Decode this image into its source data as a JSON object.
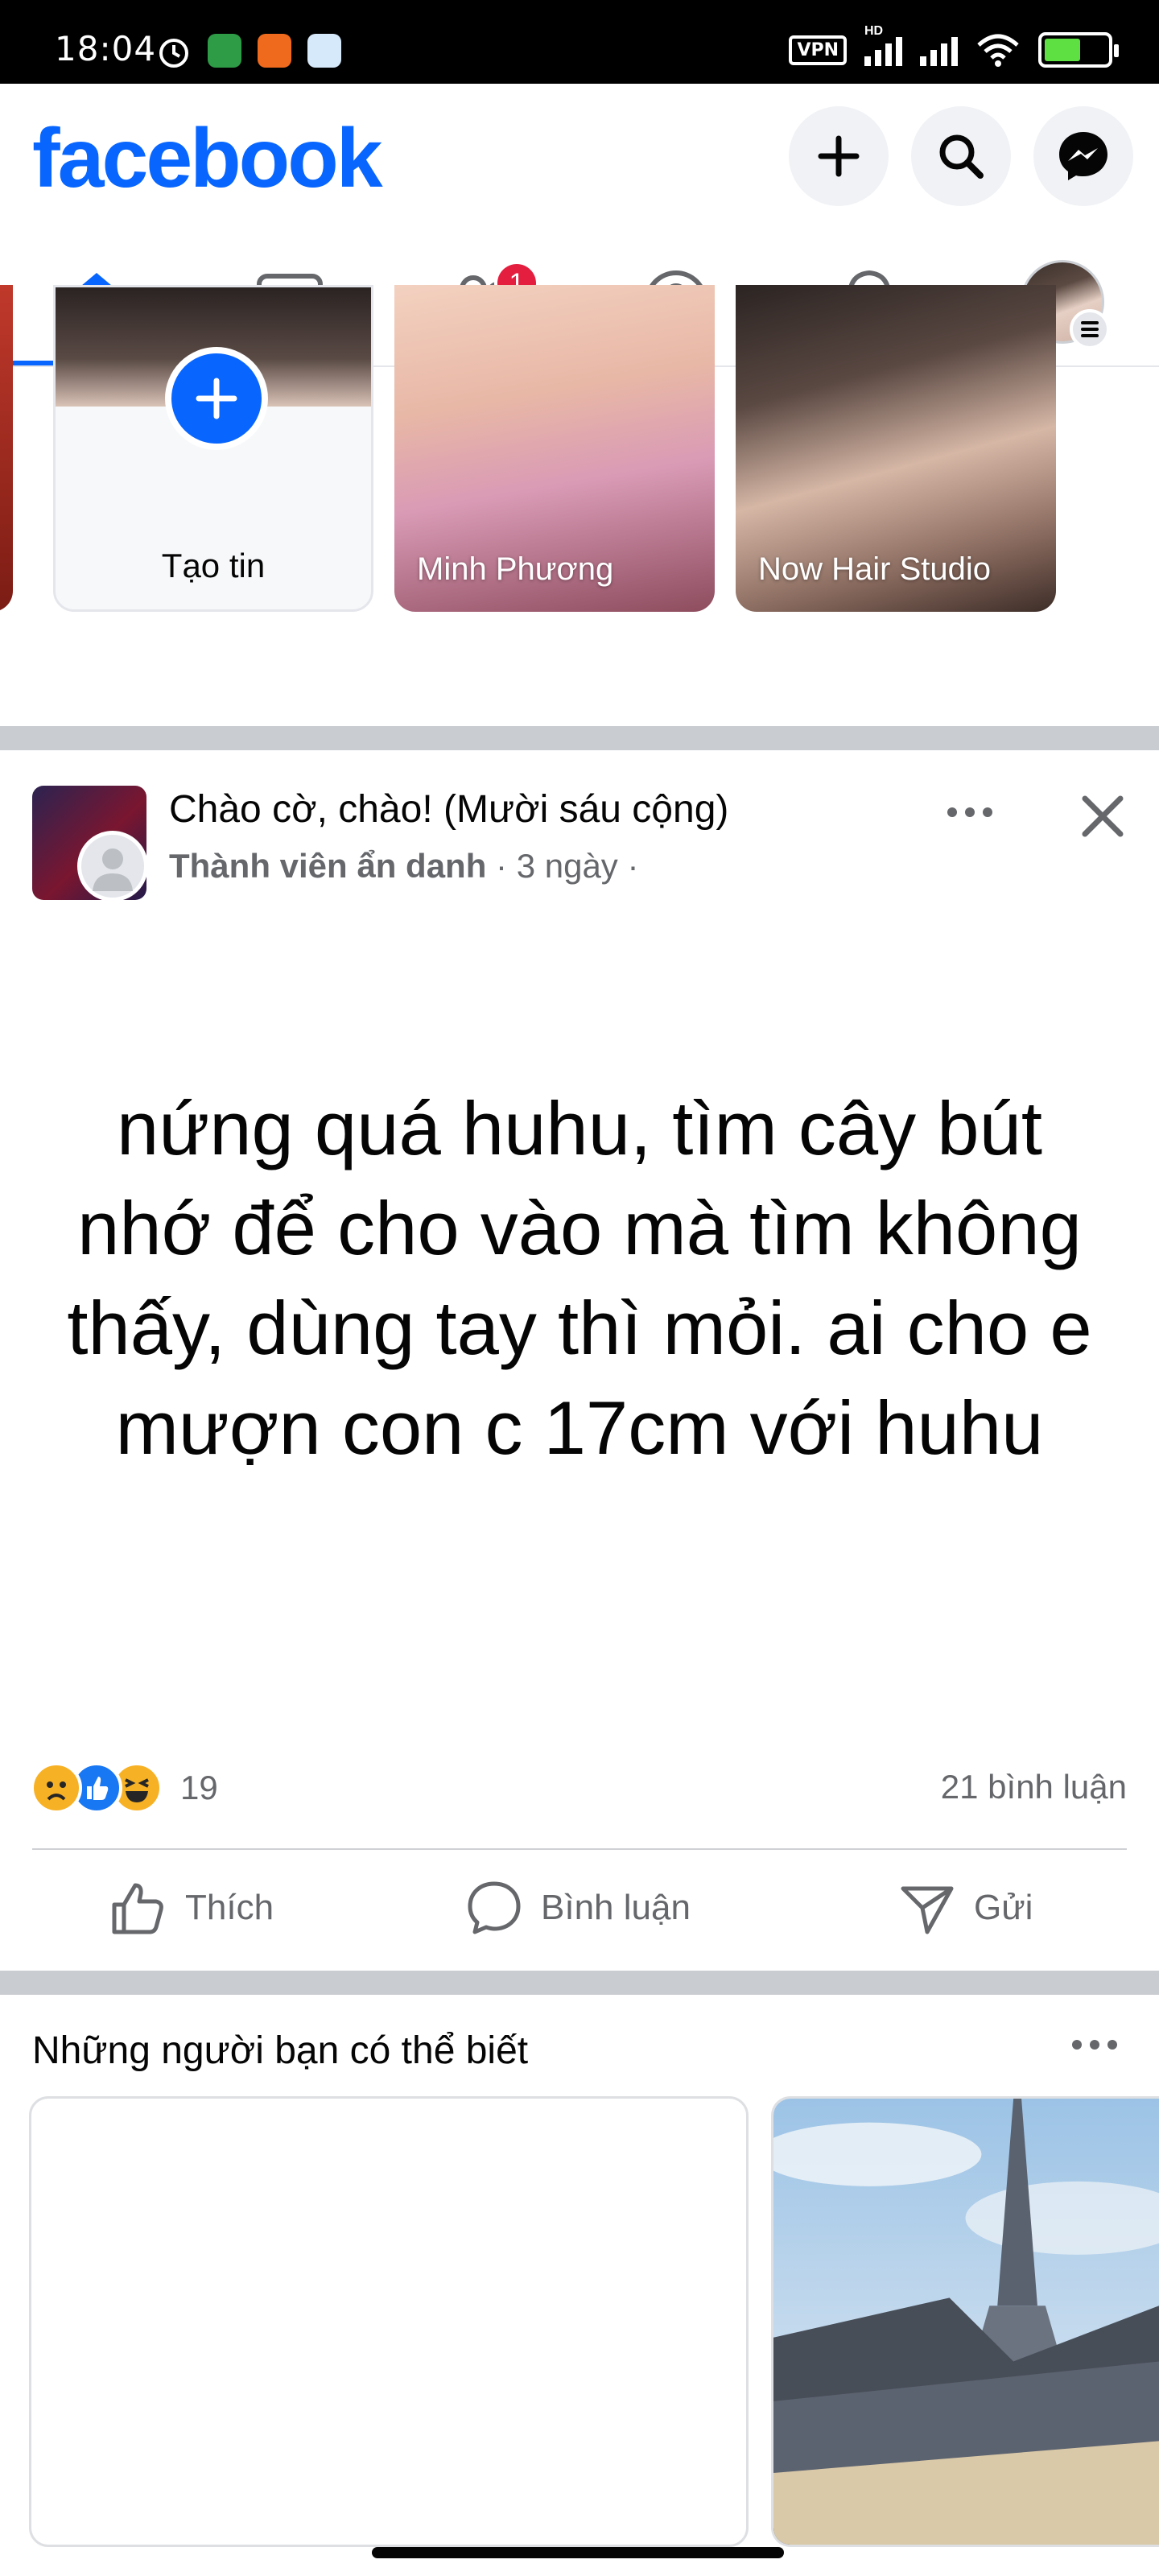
{
  "status_bar": {
    "time": "18:04",
    "vpn_label": "VPN",
    "hd_label": "HD",
    "battery_level": 0.58
  },
  "header": {
    "logo_text": "facebook",
    "brand_color": "#0866ff"
  },
  "tabs": {
    "friends_badge": "1",
    "active": "home"
  },
  "stories": {
    "create_label": "Tạo tin",
    "items": [
      {
        "name": "Minh Phương"
      },
      {
        "name": "Now Hair Studio"
      }
    ]
  },
  "post": {
    "title": "Chào cờ, chào! (Mười sáu cộng)",
    "author": "Thành viên ẩn danh",
    "time_text": "· 3 ngày ·",
    "body": "nứng quá huhu, tìm cây bút nhớ để cho vào mà tìm không thấy, dùng tay thì mỏi. ai cho e mượn con c 17cm với huhu",
    "reaction_count": "19",
    "comments_text": "21 bình luận",
    "actions": {
      "like": "Thích",
      "comment": "Bình luận",
      "send": "Gửi"
    }
  },
  "pymk": {
    "title": "Những người bạn có thể biết"
  }
}
